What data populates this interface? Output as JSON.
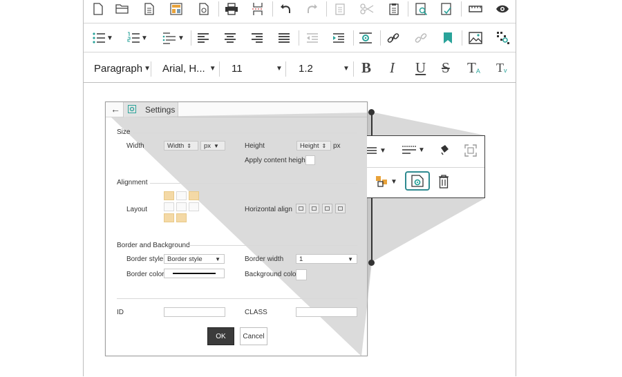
{
  "toolbar": {
    "row1_icons": [
      "new-document",
      "open-folder",
      "document",
      "template",
      "paste-text",
      "print",
      "page-break",
      "undo",
      "redo",
      "paste",
      "cut",
      "copy",
      "find",
      "replace",
      "ruler",
      "preview"
    ],
    "row2_icons": [
      "bullet-list",
      "numbered-list",
      "multilevel-list",
      "align-left",
      "align-center",
      "align-right",
      "justify",
      "outdent",
      "indent",
      "settings",
      "link",
      "unlink",
      "bookmark",
      "image",
      "special"
    ],
    "paragraph_label": "Paragraph",
    "font_label": "Arial, H...",
    "size_label": "11",
    "line_height_label": "1.2",
    "format_buttons": [
      "B",
      "I",
      "U",
      "S",
      "T",
      "T"
    ]
  },
  "dialog": {
    "back_label": "←",
    "tab_label": "Settings",
    "size_section": "Size",
    "width_label": "Width",
    "width_value": "Width",
    "width_unit": "px",
    "height_label": "Height",
    "height_value": "Height",
    "height_unit": "px",
    "apply_content_height": "Apply content height",
    "alignment_section": "Alignment",
    "layout_label": "Layout",
    "halign_label": "Horizontal align",
    "border_section": "Border and Background",
    "border_style_label": "Border style",
    "border_style_value": "Border style",
    "border_width_label": "Border width",
    "border_width_value": "1",
    "border_color_label": "Border color",
    "bg_color_label": "Background color",
    "id_label": "ID",
    "class_label": "CLASS",
    "ok_label": "OK",
    "cancel_label": "Cancel"
  },
  "colors": {
    "accent_teal": "#2e8a8f",
    "bookmark_teal": "#2aa39a",
    "template_orange": "#e8a23a",
    "layout_orange": "#f4d9a6"
  }
}
